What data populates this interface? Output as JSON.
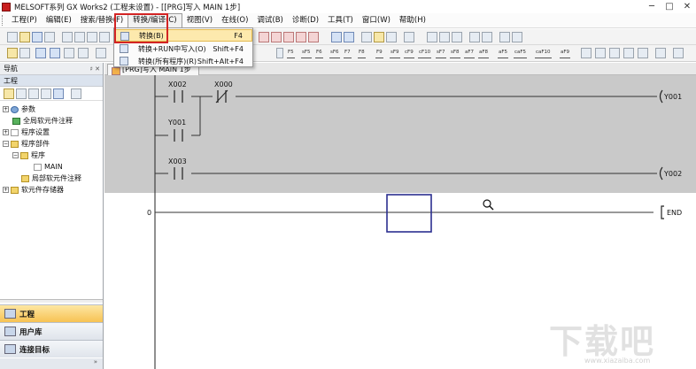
{
  "window": {
    "title": "MELSOFT系列 GX Works2 (工程未设置) - [[PRG]写入 MAIN 1步]",
    "controls": [
      "─",
      "□",
      "✕"
    ]
  },
  "menubar": {
    "items": [
      {
        "label": "工程(P)"
      },
      {
        "label": "编辑(E)"
      },
      {
        "label": "搜索/替换(F)"
      },
      {
        "label": "转换/编译(C)"
      },
      {
        "label": "视图(V)"
      },
      {
        "label": "在线(O)"
      },
      {
        "label": "调试(B)"
      },
      {
        "label": "诊断(D)"
      },
      {
        "label": "工具(T)"
      },
      {
        "label": "窗口(W)"
      },
      {
        "label": "帮助(H)"
      }
    ]
  },
  "popup": {
    "items": [
      {
        "label": "转换(B)",
        "shortcut": "F4"
      },
      {
        "label": "转换+RUN中写入(O)",
        "shortcut": "Shift+F4"
      },
      {
        "label": "转换(所有程序)(R)",
        "shortcut": "Shift+Alt+F4"
      }
    ]
  },
  "toolbar": {
    "fkeys": [
      "F5",
      "sF5",
      "F6",
      "sF6",
      "F7",
      "F8",
      "F9",
      "sF9",
      "cF9",
      "cF10",
      "sF7",
      "sF8",
      "aF7",
      "aF8",
      "aF5",
      "caF5",
      "caF10",
      "aF9"
    ]
  },
  "nav": {
    "header": "导航",
    "pin": "♯ ✕",
    "project_label": "工程",
    "tree": [
      {
        "label": "参数"
      },
      {
        "label": "全局软元件注释"
      },
      {
        "label": "程序设置"
      },
      {
        "label": "程序部件"
      },
      {
        "label": "程序"
      },
      {
        "label": "MAIN"
      },
      {
        "label": "局部软元件注释"
      },
      {
        "label": "软元件存储器"
      }
    ],
    "categories": [
      {
        "label": "工程"
      },
      {
        "label": "用户库"
      },
      {
        "label": "连接目标"
      }
    ]
  },
  "editor": {
    "tab_label": "[PRG]写入 MAIN 1步",
    "contacts": {
      "x002": "X002",
      "x000": "X000",
      "y001_in": "Y001",
      "x003": "X003"
    },
    "coils": {
      "y001": "Y001",
      "y002": "Y002"
    },
    "step": "0",
    "end": "END"
  },
  "watermark": {
    "text": "下载吧",
    "url": "www.xiazaiba.com"
  },
  "colors": {
    "highlight_box": "#d32424",
    "cursor": "#2b2f8f",
    "selected_category": "#f7c253"
  }
}
